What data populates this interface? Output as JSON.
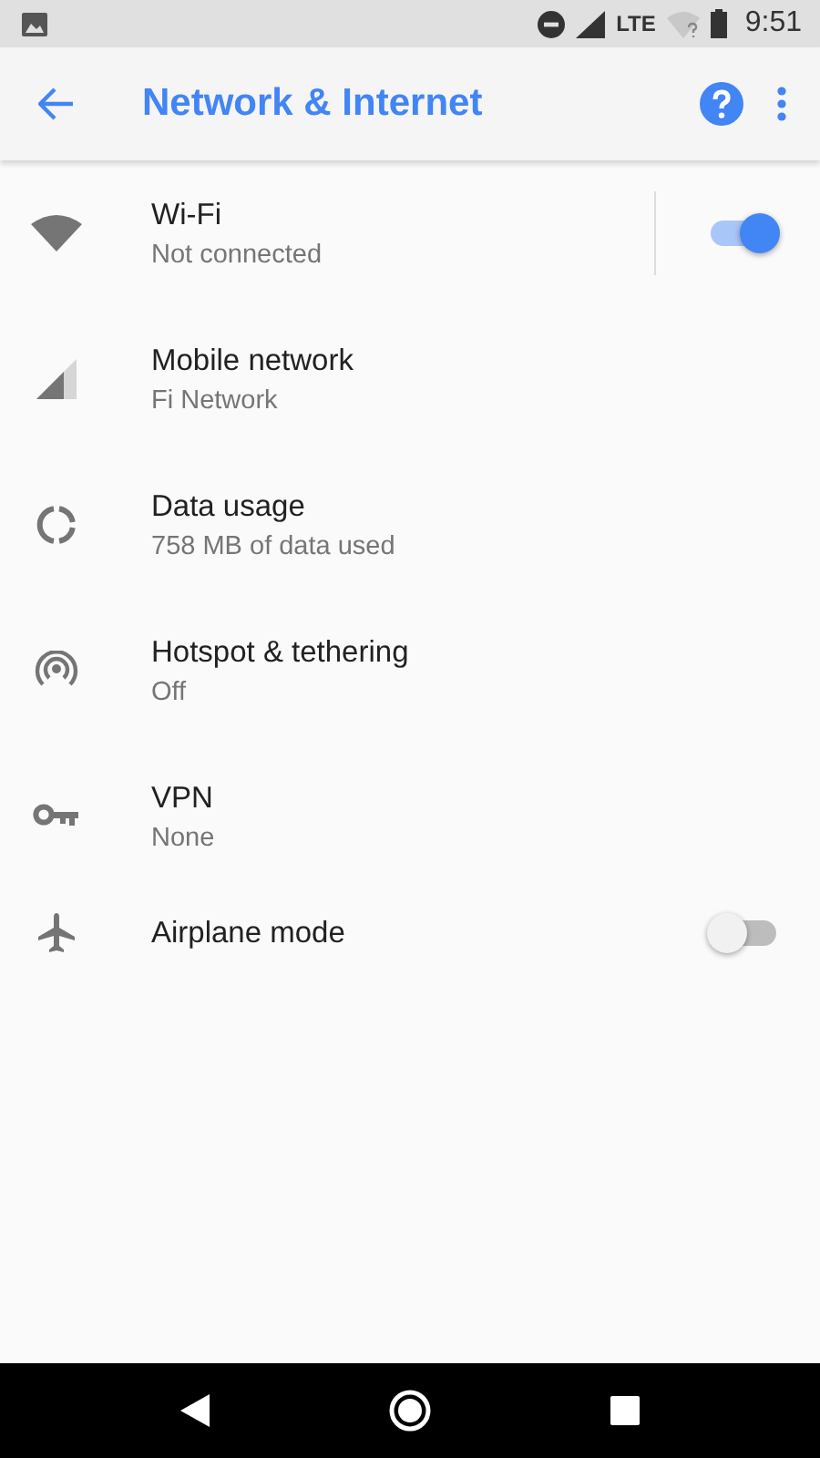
{
  "status_bar": {
    "network_type": "LTE",
    "time": "9:51"
  },
  "toolbar": {
    "title": "Network & Internet"
  },
  "settings": [
    {
      "kind": "toggle",
      "title": "Wi-Fi",
      "subtitle": "Not connected",
      "on": true
    },
    {
      "kind": "link",
      "title": "Mobile network",
      "subtitle": "Fi Network"
    },
    {
      "kind": "link",
      "title": "Data usage",
      "subtitle": "758 MB of data used"
    },
    {
      "kind": "link",
      "title": "Hotspot & tethering",
      "subtitle": "Off"
    },
    {
      "kind": "link",
      "title": "VPN",
      "subtitle": "None"
    },
    {
      "kind": "toggle",
      "title": "Airplane mode",
      "on": false
    }
  ]
}
